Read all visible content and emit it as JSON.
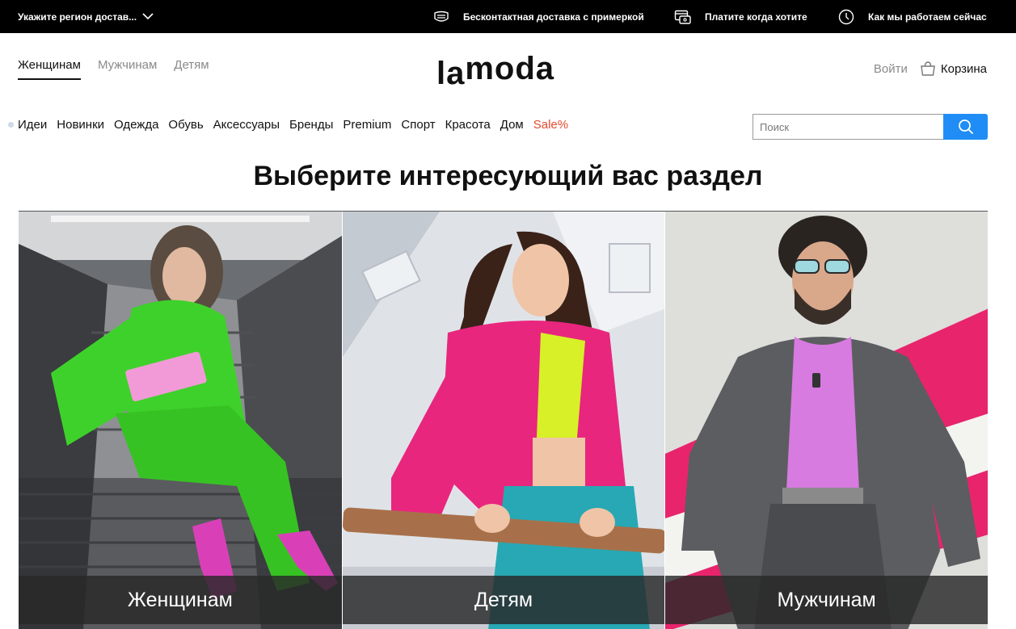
{
  "topbar": {
    "region_label": "Укажите регион достав...",
    "region_icon": "chevron-down-icon",
    "perks": [
      {
        "icon": "mask-icon",
        "label": "Бесконтактная доставка с примеркой"
      },
      {
        "icon": "card-icon",
        "label": "Платите когда хотите"
      },
      {
        "icon": "clock-icon",
        "label": "Как мы работаем сейчас"
      }
    ]
  },
  "header": {
    "gender_tabs": [
      "Женщинам",
      "Мужчинам",
      "Детям"
    ],
    "active_tab": "Женщинам",
    "logo_la": "la",
    "logo_moda": "moda",
    "login_label": "Войти",
    "cart_label": "Корзина"
  },
  "categories": [
    "Идеи",
    "Новинки",
    "Одежда",
    "Обувь",
    "Аксессуары",
    "Бренды",
    "Premium",
    "Спорт",
    "Красота",
    "Дом",
    "Sale%"
  ],
  "search": {
    "placeholder": "Поиск",
    "value": ""
  },
  "main": {
    "title": "Выберите интересующий вас раздел",
    "sections": [
      "Женщинам",
      "Детям",
      "Мужчинам"
    ]
  },
  "colors": {
    "topbar_bg": "#000000",
    "accent_blue": "#1f8df5",
    "sale_red": "#e24a2c",
    "women_suit": "#3fd12b",
    "girl_jacket": "#e8267e",
    "men_shirt": "#d77be0"
  }
}
